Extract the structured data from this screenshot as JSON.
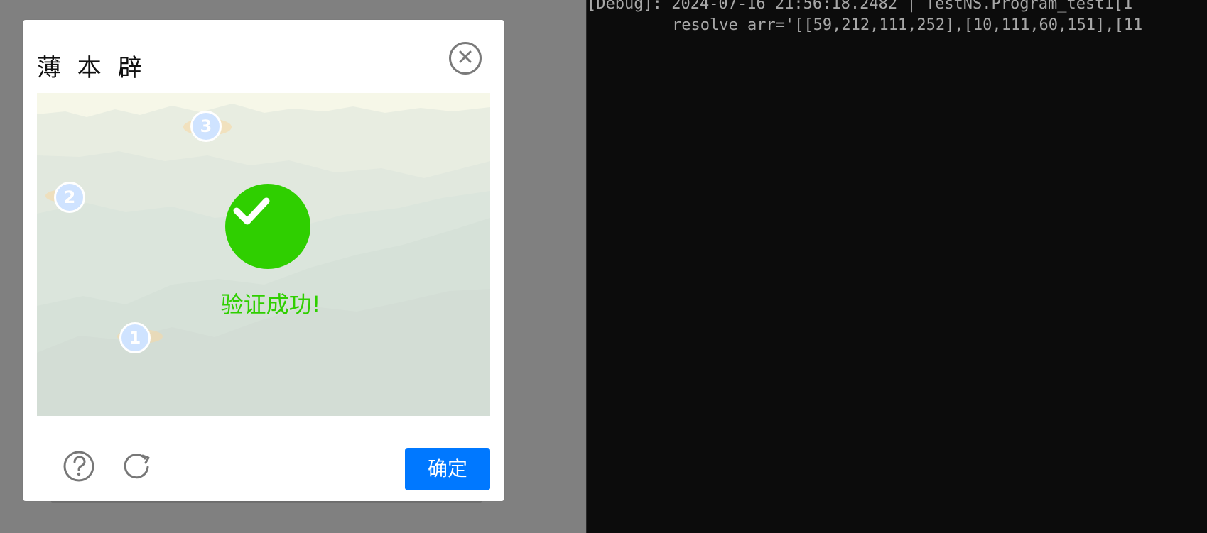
{
  "captcha": {
    "title": "薄 本 辟",
    "status_text": "验证成功!",
    "confirm_label": "确定",
    "markers": [
      "1",
      "2",
      "3"
    ]
  },
  "console": {
    "line_1": "[Debug]: 2024-07-16 21:56:18.2482 | TestNS.Program_test1[1",
    "line_2": "resolve arr='[[59,212,111,252],[10,111,60,151],[11"
  },
  "icons": {
    "close": "close-icon",
    "help": "help-icon",
    "refresh": "refresh-icon",
    "success": "check-icon"
  },
  "colors": {
    "success": "#2fcf00",
    "primary": "#0078ff",
    "console_bg": "#0c0c0c",
    "overlay_bg": "#808080",
    "marker_fill": "#cfe3ff"
  }
}
